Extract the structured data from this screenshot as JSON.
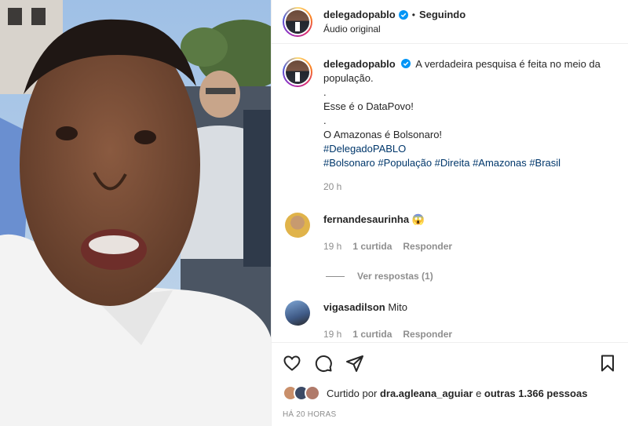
{
  "post": {
    "username": "delegadopablo",
    "dot": "•",
    "follow_status": "Seguindo",
    "audio": "Áudio original"
  },
  "caption": {
    "username": "delegadopablo",
    "line1": "A verdadeira pesquisa é feita no meio da população.",
    "line2": ".",
    "line3": "Esse é o DataPovo!",
    "line4": ".",
    "line5": "O Amazonas é Bolsonaro!",
    "hashtags_line1": "#DelegadoPABLO",
    "hashtags_line2": "#Bolsonaro #População #Direita #Amazonas #Brasil",
    "time": "20 h"
  },
  "comments": [
    {
      "username": "fernandesaurinha",
      "text": "😱",
      "time": "19 h",
      "likes": "1 curtida",
      "reply": "Responder",
      "view_replies": "Ver respostas (1)"
    },
    {
      "username": "vigasadilson",
      "text": "Mito",
      "time": "19 h",
      "likes": "1 curtida",
      "reply": "Responder"
    }
  ],
  "likes": {
    "prefix": "Curtido por",
    "user": "dra.agleana_aguiar",
    "middle": "e",
    "others": "outras 1.366 pessoas"
  },
  "timestamp": "HÁ 20 HORAS",
  "icons": {
    "verified": "verified-badge-icon",
    "like": "heart-icon",
    "comment": "comment-icon",
    "share": "send-icon",
    "save": "bookmark-icon"
  },
  "colors": {
    "verified": "#0095f6",
    "hashtag": "#00376b",
    "muted": "#8e8e8e"
  }
}
